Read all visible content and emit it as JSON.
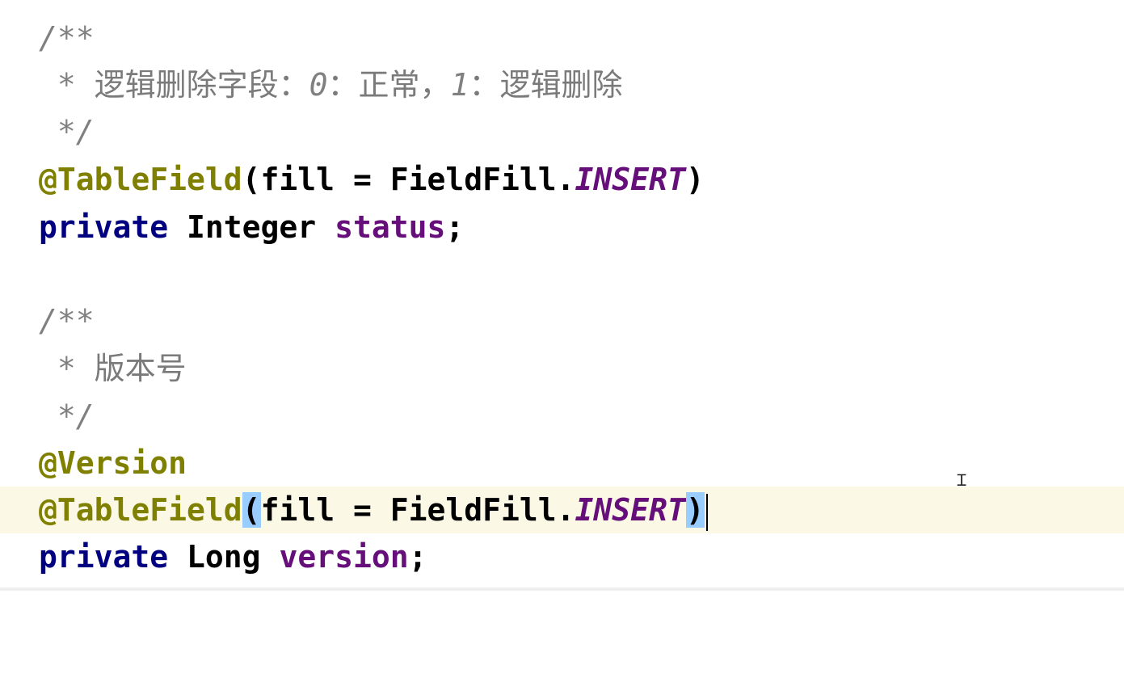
{
  "editor": {
    "lines": [
      {
        "parts": [
          "/**"
        ]
      },
      {
        "parts": [
          " * ",
          "逻辑删除字段：",
          "0",
          "：正常，",
          "1",
          "：逻辑删除"
        ]
      },
      {
        "parts": [
          " */"
        ]
      },
      {
        "parts": [
          "@TableField",
          "(fill = FieldFill.",
          "INSERT",
          ")"
        ]
      },
      {
        "parts": [
          "private",
          " Integer ",
          "status",
          ";"
        ]
      },
      {
        "parts": [
          ""
        ]
      },
      {
        "parts": [
          "/**"
        ]
      },
      {
        "parts": [
          " * ",
          "版本号"
        ]
      },
      {
        "parts": [
          " */"
        ]
      },
      {
        "parts": [
          "@Version"
        ]
      },
      {
        "parts": [
          "@TableField",
          "(",
          "fill = FieldFill.",
          "INSERT",
          ")"
        ]
      },
      {
        "parts": [
          "private",
          " Long ",
          "version",
          ";"
        ]
      }
    ],
    "highlighted_line_index": 10
  },
  "colors": {
    "background": "#ffffff",
    "current_line": "#fbf9e6",
    "comment": "#808080",
    "annotation": "#808000",
    "keyword": "#000080",
    "field": "#660e7a",
    "brace_match": "#99ccff"
  },
  "cursor": {
    "icon": "text-ibeam-cursor-icon"
  }
}
